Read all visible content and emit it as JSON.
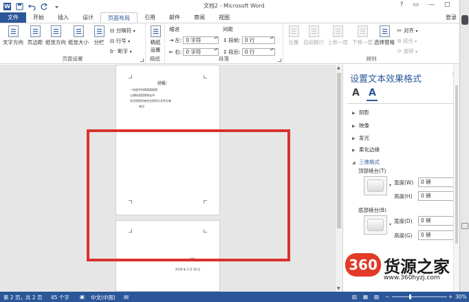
{
  "app": {
    "window_title": "文档2 - Microsoft Word",
    "login": "登录"
  },
  "quick_access": {
    "logo_text": "W",
    "icons": [
      "save-icon",
      "undo-icon",
      "redo-icon",
      "customize-icon"
    ]
  },
  "window_controls": {
    "help": "?",
    "restore": "▭",
    "minimize": "—",
    "maximize": "□",
    "close": "✕"
  },
  "tabs": [
    "文件",
    "开始",
    "插入",
    "设计",
    "页面布局",
    "引用",
    "邮件",
    "审阅",
    "视图"
  ],
  "active_tab": "页面布局",
  "ribbon": {
    "page_setup": {
      "label": "页面设置",
      "buttons": [
        "文字方向",
        "页边距",
        "纸张方向",
        "纸张大小",
        "分栏"
      ],
      "small": [
        "分隔符",
        "行号",
        "断字"
      ]
    },
    "manuscript": {
      "label": "稿纸",
      "button_line1": "稿纸",
      "button_line2": "设置"
    },
    "paragraph": {
      "label": "段落",
      "indent_title": "缩进",
      "spacing_title": "间距",
      "indent_left_label": "左:",
      "indent_left_value": "0 字符",
      "indent_right_label": "右:",
      "indent_right_value": "0 字符",
      "space_before_label": "段前:",
      "space_before_value": "0 行",
      "space_after_label": "段后:",
      "space_after_value": "0 行"
    },
    "arrange": {
      "label": "排列",
      "buttons": [
        "位置",
        "自动换行",
        "上移一层",
        "下移一层",
        "选择窗格"
      ],
      "small": [
        "对齐",
        "组合",
        "旋转"
      ]
    }
  },
  "document": {
    "page1": {
      "title": "综报：",
      "lines": [
        "一份很平时两两两两两",
        "心想你说您得知出书",
        "在在找您的来住在您的大文件分来",
        "来点"
      ]
    },
    "page2": {
      "mark": "xxx",
      "date": "2018 年 2 月 18 日"
    }
  },
  "format_pane": {
    "title": "设置文本效果格式",
    "close": "✕",
    "tab_fill_outline": "A",
    "tab_effects": "A",
    "sections": [
      {
        "label": "阴影",
        "open": false
      },
      {
        "label": "映像",
        "open": false
      },
      {
        "label": "发光",
        "open": false
      },
      {
        "label": "柔化边缘",
        "open": false
      },
      {
        "label": "三维格式",
        "open": true
      }
    ],
    "top_bevel": {
      "label": "顶部棱台(T)",
      "width_label": "宽度(W)",
      "width_value": "0 磅",
      "height_label": "高度(H)",
      "height_value": "0 磅"
    },
    "bottom_bevel": {
      "label": "底部棱台(B)",
      "width_label": "宽度(D)",
      "width_value": "0 磅",
      "height_label": "高度(G)",
      "height_value": "0 磅"
    }
  },
  "status": {
    "page": "第 2 页，共 2 页",
    "words": "45 个字",
    "language": "中文(中国)",
    "zoom": "30%"
  },
  "watermark": {
    "logo": "360",
    "title": "货源之家",
    "url": "www.360hyzj.com"
  },
  "colors": {
    "accent": "#2b579a",
    "highlight_box": "#d9322d",
    "watermark_logo": "#e23a26"
  }
}
